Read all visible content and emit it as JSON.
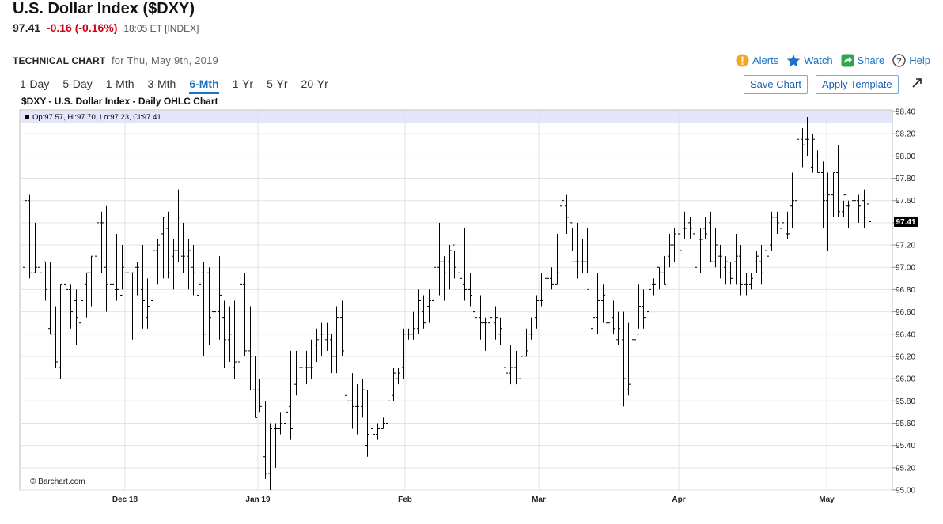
{
  "header": {
    "title": "U.S. Dollar Index ($DXY)",
    "last": "97.41",
    "change": "-0.16 (-0.16%)",
    "meta": "18:05 ET [INDEX]"
  },
  "toolbar": {
    "label": "TECHNICAL CHART",
    "date": "for Thu, May 9th, 2019",
    "alerts": "Alerts",
    "watch": "Watch",
    "share": "Share",
    "help": "Help"
  },
  "periods": [
    "1-Day",
    "5-Day",
    "1-Mth",
    "3-Mth",
    "6-Mth",
    "1-Yr",
    "5-Yr",
    "20-Yr"
  ],
  "active_period": "6-Mth",
  "buttons": {
    "save": "Save Chart",
    "apply": "Apply Template"
  },
  "chart_title": "$DXY - U.S. Dollar Index - Daily OHLC Chart",
  "ohlc_summary": "Op:97.57, Hi:97.70, Lo:97.23, Cl:97.41",
  "copyright": "© Barchart.com",
  "last_price_label": "97.41",
  "colors": {
    "accent": "#1a73c8",
    "negative": "#d0021b",
    "summary_band": "#e4e4fb",
    "bars": "#000000"
  },
  "icons": [
    "alert-icon",
    "star-icon",
    "share-icon",
    "help-icon",
    "expand-icon"
  ],
  "chart_data": {
    "type": "ohlc",
    "title": "$DXY - U.S. Dollar Index - Daily OHLC Chart",
    "ylim": [
      95.0,
      98.4
    ],
    "y_ticks": [
      "95.00",
      "95.20",
      "95.40",
      "95.60",
      "95.80",
      "96.00",
      "96.20",
      "96.40",
      "96.60",
      "96.80",
      "97.00",
      "97.20",
      "97.40",
      "97.60",
      "97.80",
      "98.00",
      "98.20",
      "98.40"
    ],
    "x_ticks": [
      "Dec 18",
      "Jan 19",
      "Feb",
      "Mar",
      "Apr",
      "May"
    ],
    "grid": true,
    "series": [
      {
        "ohlc": [
          [
            97.0,
            97.7,
            97.0,
            97.6
          ],
          [
            97.6,
            97.65,
            96.9,
            96.95
          ],
          [
            96.95,
            97.4,
            96.95,
            97.0
          ],
          [
            97.0,
            97.4,
            96.8,
            96.95
          ],
          [
            97.05,
            97.05,
            96.7,
            96.8
          ],
          [
            96.45,
            97.05,
            96.4,
            96.4
          ],
          [
            96.4,
            96.65,
            96.1,
            96.15
          ],
          [
            96.1,
            96.85,
            96.0,
            96.85
          ],
          [
            96.85,
            96.9,
            96.4,
            96.8
          ],
          [
            96.8,
            96.85,
            96.45,
            96.6
          ],
          [
            96.7,
            96.8,
            96.3,
            96.55
          ],
          [
            96.5,
            96.8,
            96.4,
            96.7
          ],
          [
            96.85,
            96.95,
            96.55,
            96.95
          ],
          [
            96.95,
            97.1,
            96.65,
            97.1
          ],
          [
            97.1,
            97.45,
            96.9,
            97.4
          ],
          [
            97.4,
            97.5,
            96.95,
            97.4
          ],
          [
            97.0,
            97.55,
            96.6,
            96.85
          ],
          [
            96.85,
            96.95,
            96.55,
            96.85
          ],
          [
            96.8,
            97.3,
            96.7,
            96.8
          ],
          [
            96.75,
            97.2,
            96.8,
            97.0
          ],
          [
            96.95,
            97.05,
            96.75,
            96.95
          ],
          [
            96.95,
            96.95,
            96.35,
            96.95
          ],
          [
            97.0,
            97.05,
            96.75,
            97.0
          ],
          [
            96.8,
            97.2,
            96.45,
            96.7
          ],
          [
            96.55,
            96.9,
            96.45,
            96.65
          ],
          [
            96.7,
            97.2,
            96.35,
            97.15
          ],
          [
            97.15,
            97.25,
            96.85,
            97.2
          ],
          [
            97.3,
            97.45,
            96.9,
            97.45
          ],
          [
            97.35,
            97.5,
            96.9,
            96.95
          ],
          [
            97.1,
            97.25,
            96.8,
            97.15
          ],
          [
            97.15,
            97.7,
            97.05,
            97.45
          ],
          [
            97.1,
            97.4,
            96.95,
            97.1
          ],
          [
            97.1,
            97.25,
            96.8,
            97.15
          ],
          [
            97.0,
            97.2,
            96.75,
            96.95
          ],
          [
            96.75,
            97.0,
            96.45,
            96.85
          ],
          [
            96.95,
            97.05,
            96.2,
            96.4
          ],
          [
            96.95,
            97.0,
            96.3,
            96.55
          ],
          [
            96.6,
            97.0,
            96.5,
            96.6
          ],
          [
            96.6,
            97.1,
            96.35,
            96.75
          ],
          [
            96.55,
            96.7,
            96.1,
            96.35
          ],
          [
            96.35,
            96.65,
            96.15,
            96.4
          ],
          [
            96.1,
            96.7,
            96.0,
            96.15
          ],
          [
            96.15,
            96.85,
            95.8,
            96.85
          ],
          [
            96.85,
            96.95,
            96.2,
            96.25
          ],
          [
            96.25,
            96.65,
            95.9,
            96.2
          ],
          [
            95.9,
            96.2,
            95.65,
            95.65
          ],
          [
            95.9,
            96.0,
            95.7,
            95.75
          ],
          [
            95.3,
            95.8,
            95.1,
            95.15
          ],
          [
            95.15,
            95.6,
            95.0,
            95.55
          ],
          [
            95.55,
            95.6,
            95.2,
            95.55
          ],
          [
            95.55,
            95.7,
            95.5,
            95.6
          ],
          [
            95.6,
            95.8,
            95.55,
            95.7
          ],
          [
            95.75,
            96.25,
            95.45,
            95.55
          ],
          [
            95.95,
            96.25,
            95.85,
            96.0
          ],
          [
            96.1,
            96.3,
            95.95,
            96.1
          ],
          [
            96.1,
            96.25,
            95.95,
            96.1
          ],
          [
            96.1,
            96.35,
            96.0,
            96.1
          ],
          [
            96.3,
            96.45,
            96.15,
            96.35
          ],
          [
            96.4,
            96.5,
            96.2,
            96.4
          ],
          [
            96.35,
            96.5,
            96.25,
            96.4
          ],
          [
            96.35,
            96.4,
            96.05,
            96.2
          ],
          [
            96.2,
            96.65,
            96.05,
            96.55
          ],
          [
            96.55,
            96.7,
            96.2,
            96.25
          ],
          [
            95.85,
            96.1,
            95.75,
            95.8
          ],
          [
            95.8,
            96.05,
            95.55,
            95.75
          ],
          [
            95.75,
            95.95,
            95.5,
            95.75
          ],
          [
            95.75,
            96.0,
            95.65,
            95.9
          ],
          [
            95.4,
            95.9,
            95.3,
            95.5
          ],
          [
            95.55,
            95.65,
            95.2,
            95.5
          ],
          [
            95.5,
            95.6,
            95.45,
            95.55
          ],
          [
            95.55,
            95.65,
            95.55,
            95.6
          ],
          [
            95.6,
            95.85,
            95.55,
            95.8
          ],
          [
            95.85,
            96.1,
            95.8,
            96.05
          ],
          [
            96.0,
            96.1,
            95.95,
            96.05
          ],
          [
            96.1,
            96.45,
            96.0,
            96.4
          ],
          [
            96.4,
            96.45,
            96.35,
            96.4
          ],
          [
            96.4,
            96.6,
            96.35,
            96.45
          ],
          [
            96.45,
            96.8,
            96.4,
            96.7
          ],
          [
            96.6,
            96.75,
            96.45,
            96.5
          ],
          [
            96.65,
            96.8,
            96.5,
            96.7
          ],
          [
            96.7,
            97.1,
            96.6,
            97.0
          ],
          [
            97.0,
            97.4,
            96.75,
            97.05
          ],
          [
            97.05,
            97.1,
            96.7,
            96.95
          ],
          [
            97.05,
            97.2,
            96.8,
            97.15
          ],
          [
            97.2,
            97.15,
            96.9,
            97.0
          ],
          [
            96.95,
            97.05,
            96.8,
            96.9
          ],
          [
            96.85,
            97.35,
            96.7,
            96.8
          ],
          [
            96.8,
            96.95,
            96.65,
            96.75
          ],
          [
            96.6,
            96.75,
            96.4,
            96.55
          ],
          [
            96.55,
            96.75,
            96.35,
            96.5
          ],
          [
            96.5,
            96.55,
            96.25,
            96.5
          ],
          [
            96.5,
            96.65,
            96.35,
            96.55
          ],
          [
            96.5,
            96.65,
            96.35,
            96.55
          ],
          [
            96.4,
            96.55,
            96.3,
            96.45
          ],
          [
            96.1,
            96.45,
            95.95,
            96.05
          ],
          [
            96.05,
            96.3,
            95.95,
            96.1
          ],
          [
            96.1,
            96.25,
            95.95,
            96.0
          ],
          [
            96.0,
            96.35,
            95.85,
            96.2
          ],
          [
            96.2,
            96.45,
            96.2,
            96.25
          ],
          [
            96.4,
            96.55,
            96.35,
            96.4
          ],
          [
            96.55,
            96.75,
            96.45,
            96.7
          ],
          [
            96.7,
            96.95,
            96.65,
            96.7
          ],
          [
            96.9,
            96.95,
            96.85,
            96.9
          ],
          [
            96.9,
            97.0,
            96.8,
            96.85
          ],
          [
            96.85,
            97.3,
            96.85,
            96.95
          ],
          [
            97.55,
            97.7,
            97.0,
            97.6
          ],
          [
            97.55,
            97.65,
            97.3,
            97.45
          ],
          [
            97.4,
            97.35,
            97.15,
            97.05
          ],
          [
            97.05,
            97.4,
            96.9,
            97.05
          ],
          [
            97.05,
            97.25,
            96.95,
            97.05
          ],
          [
            97.05,
            97.35,
            96.95,
            96.8
          ],
          [
            96.45,
            96.8,
            96.4,
            96.55
          ],
          [
            96.55,
            96.95,
            96.4,
            96.7
          ],
          [
            96.7,
            96.85,
            96.5,
            96.75
          ],
          [
            96.5,
            96.8,
            96.45,
            96.5
          ],
          [
            96.55,
            96.7,
            96.4,
            96.45
          ],
          [
            96.35,
            96.6,
            96.3,
            96.45
          ],
          [
            96.35,
            96.6,
            95.75,
            96.0
          ],
          [
            95.9,
            96.5,
            95.85,
            95.95
          ],
          [
            96.35,
            96.85,
            96.25,
            96.35
          ],
          [
            96.4,
            96.85,
            96.45,
            96.65
          ],
          [
            96.65,
            96.8,
            96.45,
            96.55
          ],
          [
            96.6,
            96.8,
            96.45,
            96.8
          ],
          [
            96.85,
            96.9,
            96.75,
            96.85
          ],
          [
            97.0,
            97.0,
            96.8,
            96.95
          ],
          [
            96.95,
            97.1,
            96.85,
            96.85
          ],
          [
            97.1,
            97.3,
            97.0,
            97.2
          ],
          [
            97.2,
            97.35,
            97.05,
            97.3
          ],
          [
            97.3,
            97.45,
            97.0,
            97.15
          ],
          [
            97.35,
            97.5,
            97.25,
            97.35
          ],
          [
            97.4,
            97.45,
            97.25,
            97.35
          ],
          [
            97.3,
            97.3,
            96.95,
            97.0
          ],
          [
            97.25,
            97.35,
            96.95,
            97.25
          ],
          [
            97.35,
            97.45,
            97.25,
            97.3
          ],
          [
            97.4,
            97.5,
            97.05,
            97.05
          ],
          [
            97.05,
            97.35,
            97.0,
            97.2
          ],
          [
            97.1,
            97.2,
            96.9,
            97.1
          ],
          [
            97.0,
            97.1,
            96.85,
            97.05
          ],
          [
            96.95,
            97.05,
            96.85,
            96.9
          ],
          [
            97.05,
            97.3,
            96.85,
            97.1
          ],
          [
            97.1,
            97.2,
            96.75,
            96.85
          ],
          [
            96.85,
            96.95,
            96.75,
            96.85
          ],
          [
            96.85,
            96.95,
            96.8,
            96.9
          ],
          [
            97.05,
            97.15,
            96.95,
            97.1
          ],
          [
            97.05,
            97.2,
            96.85,
            96.95
          ],
          [
            97.15,
            97.25,
            96.95,
            97.1
          ],
          [
            97.2,
            97.5,
            97.15,
            97.45
          ],
          [
            97.45,
            97.5,
            97.3,
            97.4
          ],
          [
            97.35,
            97.4,
            97.25,
            97.4
          ],
          [
            97.3,
            97.5,
            97.25,
            97.3
          ],
          [
            97.55,
            97.85,
            97.35,
            97.6
          ],
          [
            97.6,
            98.25,
            97.55,
            98.15
          ],
          [
            98.15,
            98.25,
            97.9,
            98.1
          ],
          [
            98.15,
            98.35,
            98.0,
            98.15
          ],
          [
            97.9,
            98.2,
            97.85,
            98.15
          ],
          [
            98.0,
            98.05,
            97.85,
            97.85
          ],
          [
            97.85,
            97.95,
            97.35,
            97.6
          ],
          [
            97.6,
            97.85,
            97.15,
            97.65
          ],
          [
            97.65,
            97.85,
            97.45,
            97.85
          ],
          [
            97.85,
            98.1,
            97.45,
            97.5
          ],
          [
            97.5,
            97.6,
            97.45,
            97.65
          ],
          [
            97.55,
            97.6,
            97.35,
            97.55
          ],
          [
            97.6,
            97.75,
            97.45,
            97.6
          ],
          [
            97.6,
            97.65,
            97.4,
            97.55
          ],
          [
            97.6,
            97.7,
            97.35,
            97.45
          ],
          [
            97.57,
            97.7,
            97.23,
            97.41
          ]
        ]
      }
    ]
  }
}
